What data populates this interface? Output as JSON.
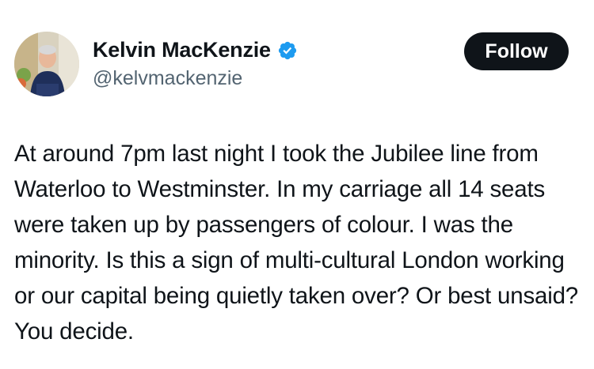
{
  "author": {
    "display_name": "Kelvin MacKenzie",
    "handle": "@kelvmackenzie",
    "verified": true,
    "verified_icon": "verified-badge-icon"
  },
  "actions": {
    "follow_label": "Follow"
  },
  "tweet": {
    "text": "At around 7pm last night I took the Jubilee line from Waterloo to Westminster. In my carriage all 14 seats were taken up by passengers of colour. I was the minority. Is this a sign of multi-cultural London working or our capital being quietly taken over? Or best unsaid? You decide."
  },
  "colors": {
    "text_primary": "#0f1419",
    "text_secondary": "#536471",
    "verified_blue": "#1d9bf0",
    "button_bg": "#0f1419",
    "button_text": "#ffffff"
  }
}
